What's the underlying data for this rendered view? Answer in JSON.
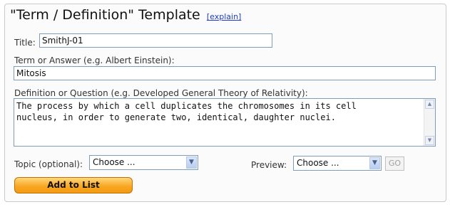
{
  "header": {
    "title": "\"Term / Definition\" Template",
    "explain_link": "[explain]"
  },
  "form": {
    "title_label": "Title:",
    "title_value": "SmithJ-01",
    "term_label": "Term or Answer (e.g. Albert Einstein):",
    "term_value": "Mitosis",
    "definition_label": "Definition or Question (e.g. Developed General Theory of Relativity):",
    "definition_value": "The process by which a cell duplicates the chromosomes in its cell\nnucleus, in order to generate two, identical, daughter nuclei.",
    "topic_label": "Topic (optional):",
    "topic_selected": "Choose ...",
    "preview_label": "Preview:",
    "preview_selected": "Choose ...",
    "go_label": "GO",
    "add_button_label": "Add to List"
  },
  "icons": {
    "dropdown": "chevron-down-icon",
    "scroll_up": "arrow-up-icon",
    "scroll_down": "arrow-down-icon"
  },
  "colors": {
    "link": "#1a3cc8",
    "add_button": "#f8a825",
    "input_border": "#7f9db9"
  }
}
